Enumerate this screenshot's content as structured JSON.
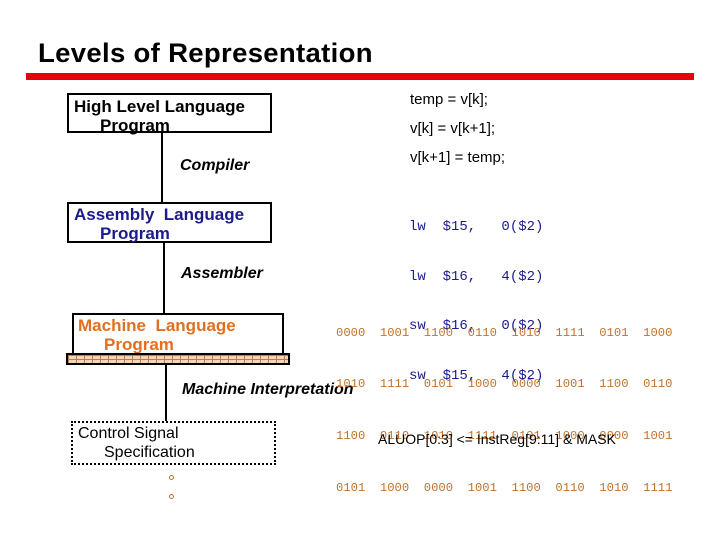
{
  "title": "Levels of Representation",
  "levels": {
    "high_level": {
      "line1": "High Level Language",
      "line2": "Program"
    },
    "assembly": {
      "line1": "Assembly  Language",
      "line2": "Program"
    },
    "machine": {
      "line1": "Machine  Language",
      "line2": "Program"
    },
    "control": {
      "line1": "Control Signal",
      "line2": "Specification"
    }
  },
  "transformations": {
    "compiler": "Compiler",
    "assembler": "Assembler",
    "machine_interpretation": "Machine Interpretation"
  },
  "high_level_code": [
    "temp = v[k];",
    "v[k] = v[k+1];",
    "v[k+1] = temp;"
  ],
  "assembly_code": [
    "lw  $15,   0($2)",
    "lw  $16,   4($2)",
    "sw  $16,   0($2)",
    "sw  $15,   4($2)"
  ],
  "machine_code": [
    "0000  1001  1100  0110  1010  1111  0101  1000",
    "1010  1111  0101  1000  0000  1001  1100  0110",
    "1100  0110  1010  1111  0101  1000  0000  1001",
    "0101  1000  0000  1001  1100  0110  1010  1111"
  ],
  "control_spec": "ALUOP[0:3] <= InstReg[9:11] & MASK",
  "colors": {
    "title_rule": "#e8000b",
    "assembly": "#1b1b8a",
    "machine": "#e07020",
    "machine_code": "#c0722b"
  }
}
